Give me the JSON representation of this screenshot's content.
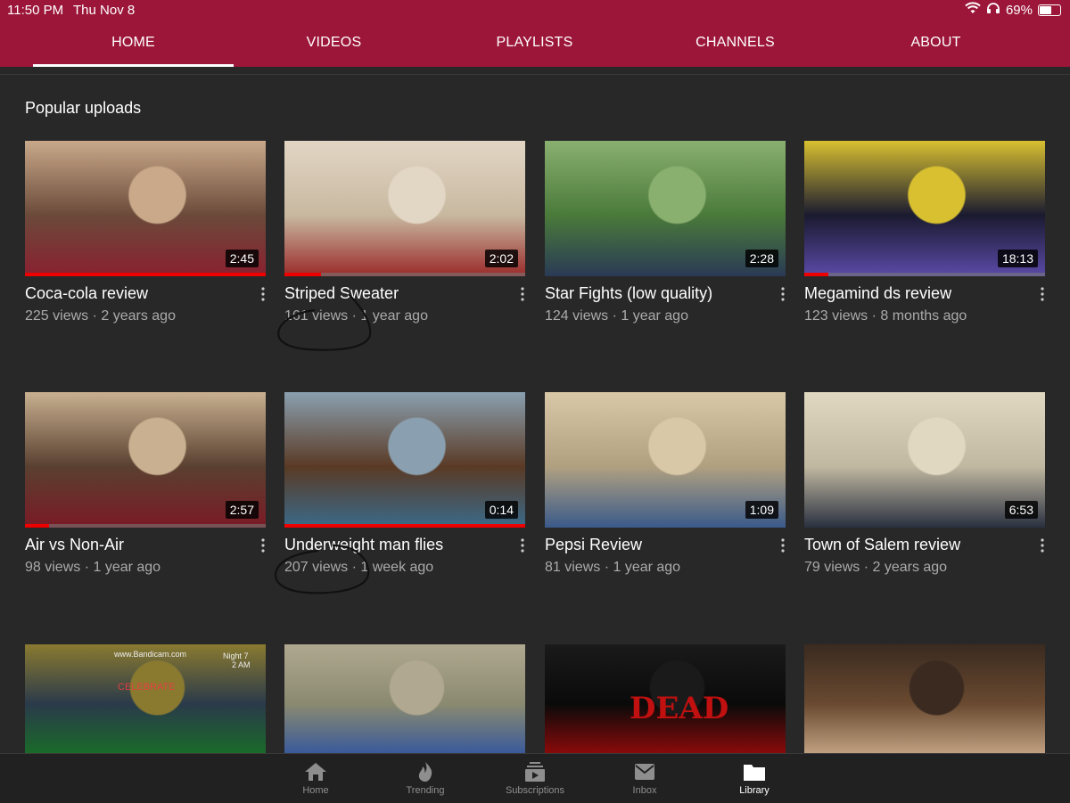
{
  "status": {
    "time": "11:50 PM",
    "date": "Thu Nov 8",
    "battery_text": "69%",
    "battery_level": 0.69
  },
  "tabs": [
    {
      "label": "HOME",
      "active": true
    },
    {
      "label": "VIDEOS",
      "active": false
    },
    {
      "label": "PLAYLISTS",
      "active": false
    },
    {
      "label": "CHANNELS",
      "active": false
    },
    {
      "label": "ABOUT",
      "active": false
    }
  ],
  "section_title": "Popular uploads",
  "videos": [
    {
      "title": "Coca-cola review",
      "meta": "225 views · 2 years ago",
      "duration": "2:45",
      "progress": 1.0,
      "colors": [
        "#6b4a3a",
        "#8a2030",
        "#c9a98a"
      ]
    },
    {
      "title": "Striped Sweater",
      "meta": "161 views · 1 year ago",
      "duration": "2:02",
      "progress": 0.15,
      "colors": [
        "#c8b8a0",
        "#9a2a2a",
        "#e2d6c4"
      ]
    },
    {
      "title": "Star Fights (low quality)",
      "meta": "124 views · 1 year ago",
      "duration": "2:28",
      "progress": 0,
      "colors": [
        "#4a7a3a",
        "#2a3a55",
        "#8ab070"
      ]
    },
    {
      "title": "Megamind ds review",
      "meta": "123 views · 8 months ago",
      "duration": "18:13",
      "progress": 0.1,
      "colors": [
        "#1a1a30",
        "#5b4aa8",
        "#d8c030"
      ]
    },
    {
      "title": "Air vs Non-Air",
      "meta": "98 views · 1 year ago",
      "duration": "2:57",
      "progress": 0.1,
      "colors": [
        "#5a4030",
        "#7a1a25",
        "#c8b090"
      ]
    },
    {
      "title": "Underweight man flies",
      "meta": "207 views · 1 week ago",
      "duration": "0:14",
      "progress": 1.0,
      "colors": [
        "#5a3a25",
        "#3a6a8a",
        "#8aa0b0"
      ]
    },
    {
      "title": "Pepsi Review",
      "meta": "81 views · 1 year ago",
      "duration": "1:09",
      "progress": 0,
      "colors": [
        "#b0a080",
        "#3a5a8a",
        "#d8c8a8"
      ]
    },
    {
      "title": "Town of Salem review",
      "meta": "79 views · 2 years ago",
      "duration": "6:53",
      "progress": 0,
      "colors": [
        "#c0b8a0",
        "#2a3040",
        "#e0d8c0"
      ]
    },
    {
      "title": "",
      "meta": "",
      "duration": "",
      "progress": 0,
      "overlay": [
        "www.Bandicam.com",
        "Night 7",
        "2 AM",
        "CELEBRATE"
      ],
      "colors": [
        "#2a3a4a",
        "#1a6a2a",
        "#8a7a30"
      ]
    },
    {
      "title": "",
      "meta": "",
      "duration": "",
      "progress": 0,
      "colors": [
        "#8a8a70",
        "#3a5a9a",
        "#b0a890"
      ]
    },
    {
      "title": "",
      "meta": "",
      "duration": "",
      "progress": 0,
      "overlay": [
        "DEAD"
      ],
      "colors": [
        "#0a0a0a",
        "#8a0a0a",
        "#1a1a1a"
      ]
    },
    {
      "title": "",
      "meta": "",
      "duration": "",
      "progress": 0,
      "colors": [
        "#6a4a30",
        "#c0a080",
        "#3a2a20"
      ]
    }
  ],
  "bottom_nav": [
    {
      "label": "Home",
      "icon": "home-icon",
      "active": false
    },
    {
      "label": "Trending",
      "icon": "trending-icon",
      "active": false
    },
    {
      "label": "Subscriptions",
      "icon": "subscriptions-icon",
      "active": false
    },
    {
      "label": "Inbox",
      "icon": "inbox-icon",
      "active": false
    },
    {
      "label": "Library",
      "icon": "library-icon",
      "active": true
    }
  ],
  "colors": {
    "brand": "#9c1639",
    "background": "#282828",
    "progress": "#ee0000"
  }
}
